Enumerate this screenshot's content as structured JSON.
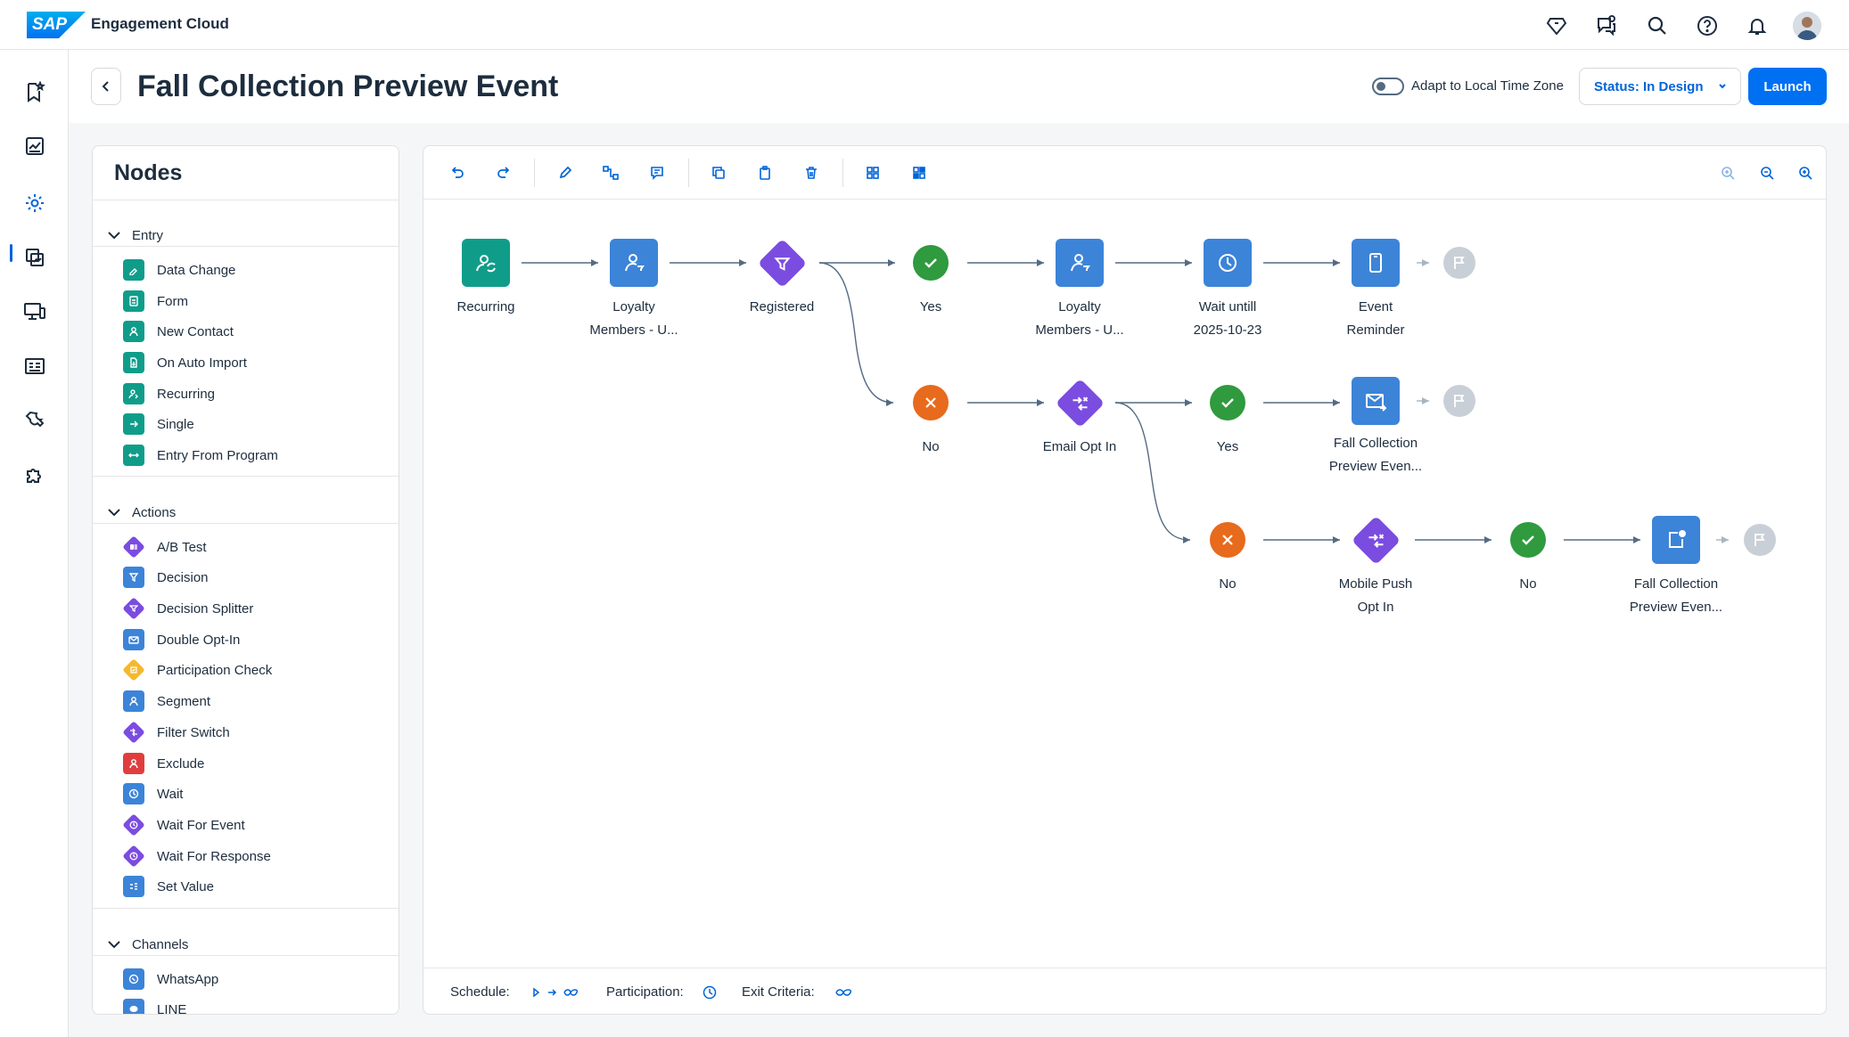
{
  "app": {
    "brand": "Engagement Cloud",
    "logo_text": "SAP"
  },
  "header": {
    "title": "Fall Collection Preview Event",
    "toggle_label": "Adapt to Local Time Zone",
    "status_label": "Status: In Design",
    "launch_label": "Launch"
  },
  "nodes_panel": {
    "title": "Nodes",
    "groups": [
      {
        "label": "Entry",
        "items": [
          "Data Change",
          "Form",
          "New Contact",
          "On Auto Import",
          "Recurring",
          "Single",
          "Entry From Program"
        ]
      },
      {
        "label": "Actions",
        "items": [
          "A/B Test",
          "Decision",
          "Decision Splitter",
          "Double Opt-In",
          "Participation Check",
          "Segment",
          "Filter Switch",
          "Exclude",
          "Wait",
          "Wait For Event",
          "Wait For Response",
          "Set Value"
        ]
      },
      {
        "label": "Channels",
        "items": [
          "WhatsApp",
          "LINE"
        ]
      }
    ]
  },
  "flow": {
    "recurring": [
      "Recurring"
    ],
    "loyalty1": [
      "Loyalty",
      "Members - U..."
    ],
    "registered": [
      "Registered"
    ],
    "yes1": [
      "Yes"
    ],
    "loyalty2": [
      "Loyalty",
      "Members - U..."
    ],
    "wait": [
      "Wait untill",
      "2025-10-23"
    ],
    "reminder": [
      "Event",
      "Reminder"
    ],
    "no1": [
      "No"
    ],
    "emailopt": [
      "Email Opt In"
    ],
    "yes2": [
      "Yes"
    ],
    "fallemail": [
      "Fall Collection",
      "Preview Even..."
    ],
    "no2": [
      "No"
    ],
    "mobileopt": [
      "Mobile Push",
      "Opt In"
    ],
    "no3": [
      "No"
    ],
    "fallpush": [
      "Fall Collection",
      "Preview Even..."
    ]
  },
  "footer": {
    "schedule_label": "Schedule:",
    "participation_label": "Participation:",
    "exit_label": "Exit Criteria:"
  },
  "colors": {
    "teal": "#0f9d8a",
    "blue": "#3c84d8",
    "purple": "#7b4ce0",
    "green": "#2f9a3e",
    "orange": "#e86a1c",
    "red": "#e03e3e",
    "yellow": "#f5b82e",
    "accent": "#0070f2"
  }
}
